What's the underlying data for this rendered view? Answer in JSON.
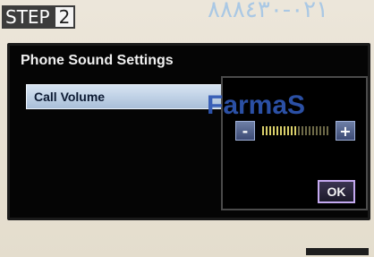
{
  "step": {
    "word": "STEP",
    "number": "2"
  },
  "watermark": {
    "top": "٠٢١-٨٨٨٤٣٠",
    "middle": "FarmaS"
  },
  "screen": {
    "title": "Phone Sound Settings",
    "list": [
      {
        "label": "Call Volume",
        "selected": true
      }
    ],
    "volume_popup": {
      "minus_label": "-",
      "plus_label": "+",
      "level_fraction": 0.55,
      "ok_label": "OK"
    }
  },
  "colors": {
    "selection_gradient": "#a9bfd9",
    "ok_border": "#c4a9f0",
    "volume_on": "#d9cf6a",
    "watermark_blue": "#2f57b4"
  }
}
